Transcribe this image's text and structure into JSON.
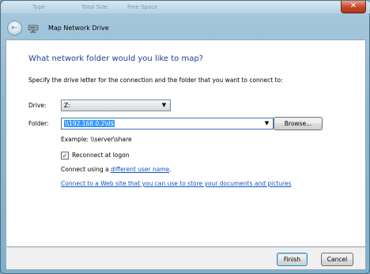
{
  "background_window": {
    "columns": [
      "Type",
      "Total Size",
      "Free Space"
    ]
  },
  "window": {
    "title": "Map Network Drive",
    "close_label": "✕",
    "back_icon": "back-arrow-icon",
    "app_icon": "network-drive-icon"
  },
  "content": {
    "heading": "What network folder would you like to map?",
    "instruction": "Specify the drive letter for the connection and the folder that you want to connect to:",
    "drive_label": "Drive:",
    "drive_value": "Z:",
    "folder_label": "Folder:",
    "folder_value": "\\\\192.168.0.2\\d$",
    "browse_label": "Browse...",
    "example": "Example: \\\\server\\share",
    "reconnect_label": "Reconnect at logon",
    "reconnect_checked": true,
    "connect_using_prefix": "Connect using a ",
    "different_user_link": "different user name",
    "connect_using_suffix": ".",
    "website_link": "Connect to a Web site that you can use to store your documents and pictures"
  },
  "footer": {
    "finish_label": "Finish",
    "cancel_label": "Cancel"
  },
  "colors": {
    "heading": "#1e3f8f",
    "link": "#0b55c4",
    "selection": "#3399ff"
  }
}
